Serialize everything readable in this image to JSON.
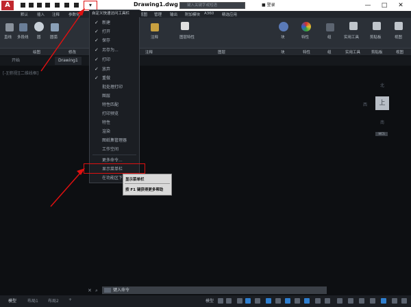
{
  "app": {
    "logo_letter": "A",
    "document_title": "Drawing1.dwg"
  },
  "search": {
    "placeholder": "键入关键字或短语"
  },
  "login": {
    "label": "登录"
  },
  "window_controls": {
    "minimize": "—",
    "maximize": "□",
    "close": "✕"
  },
  "menubar": {
    "tabs": [
      "默认",
      "插入",
      "注释",
      "参数化",
      "视图",
      "管理",
      "输出",
      "附加模块",
      "A360",
      "精选应用"
    ]
  },
  "ribbon": {
    "tools": [
      "直线",
      "多段线",
      "圆",
      "圆弧",
      "注释",
      "图层特性",
      "块",
      "特性",
      "组",
      "实用工具",
      "剪贴板",
      "视图"
    ],
    "panels": [
      "绘图",
      "修改",
      "注释",
      "图层",
      "块",
      "特性",
      "组",
      "实用工具",
      "剪贴板",
      "视图"
    ]
  },
  "file_tabs": {
    "start": "开始",
    "drawing": "Drawing1"
  },
  "viewport": {
    "label": "[-][俯视][二维线框]",
    "cube": {
      "north": "北",
      "top": "上",
      "south": "南",
      "west": "西",
      "wcs": "WCS"
    }
  },
  "quick_access_menu": {
    "header": "自定义快速访问工具栏",
    "items": [
      {
        "label": "新建",
        "checked": "✓"
      },
      {
        "label": "打开",
        "checked": "✓"
      },
      {
        "label": "保存",
        "checked": "✓"
      },
      {
        "label": "另存为...",
        "checked": "✓"
      },
      {
        "label": "打印",
        "checked": "✓"
      },
      {
        "label": "放弃",
        "checked": "✓"
      },
      {
        "label": "重做",
        "checked": "✓"
      },
      {
        "label": "批处理打印",
        "checked": ""
      },
      {
        "label": "图层",
        "checked": ""
      },
      {
        "label": "特性匹配",
        "checked": ""
      },
      {
        "label": "打印预览",
        "checked": ""
      },
      {
        "label": "特性",
        "checked": ""
      },
      {
        "label": "渲染",
        "checked": ""
      },
      {
        "label": "图纸集管理器",
        "checked": ""
      },
      {
        "label": "工作空间",
        "checked": ""
      },
      {
        "label": "更多命令...",
        "checked": ""
      },
      {
        "label": "显示菜单栏",
        "checked": ""
      },
      {
        "label": "在功能区下方显示",
        "checked": ""
      }
    ]
  },
  "tooltip": {
    "title": "显示菜单栏",
    "help": "按 F1 键获得更多帮助"
  },
  "command": {
    "placeholder": "键入命令"
  },
  "status": {
    "tabs": [
      "模型",
      "布局1",
      "布局2"
    ],
    "space_label": "模型"
  },
  "colors": {
    "highlight": "#e01010",
    "background": "#0d0f12",
    "ribbon": "#2b3037"
  }
}
